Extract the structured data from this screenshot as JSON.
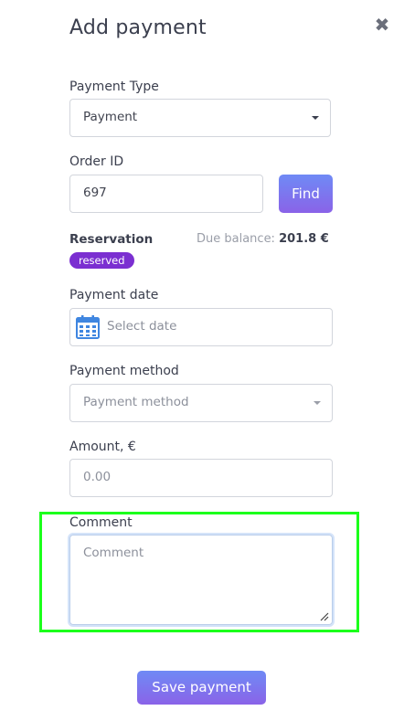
{
  "dialog": {
    "title": "Add payment",
    "close_icon": "close-icon",
    "close_symbol": "✖"
  },
  "payment_type": {
    "label": "Payment Type",
    "value": "Payment"
  },
  "order": {
    "label": "Order ID",
    "value": "697",
    "find_label": "Find"
  },
  "reservation": {
    "label": "Reservation",
    "due_label": "Due balance:",
    "due_value": "201.8 €",
    "status": "reserved"
  },
  "payment_date": {
    "label": "Payment date",
    "placeholder": "Select date",
    "icon": "calendar-icon"
  },
  "payment_method": {
    "label": "Payment method",
    "placeholder": "Payment method"
  },
  "amount": {
    "label": "Amount, €",
    "placeholder": "0.00"
  },
  "comment": {
    "label": "Comment",
    "placeholder": "Comment"
  },
  "actions": {
    "save_label": "Save payment"
  },
  "colors": {
    "accent_gradient_start": "#6f8af5",
    "accent_gradient_end": "#8a63e8",
    "badge": "#7b2fd1",
    "highlight": "#1bff1b"
  }
}
